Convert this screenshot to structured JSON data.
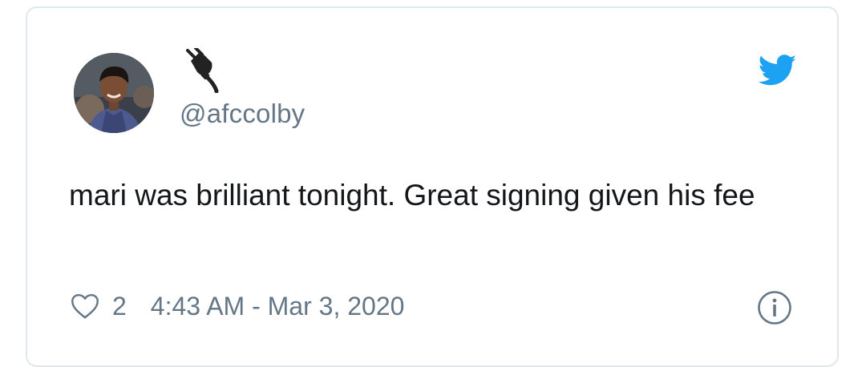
{
  "tweet": {
    "handle": "@afccolby",
    "text": "mari was brilliant tonight. Great signing given his fee",
    "like_count": "2",
    "timestamp": "4:43 AM - Mar 3, 2020"
  },
  "icons": {
    "display_name_emoji": "electric-plug-icon",
    "brand": "twitter-bird-icon",
    "like": "heart-icon",
    "info": "info-icon"
  },
  "colors": {
    "twitter_blue": "#1da1f2",
    "text_primary": "#14171a",
    "text_secondary": "#657786",
    "border": "#e1e8ed"
  }
}
